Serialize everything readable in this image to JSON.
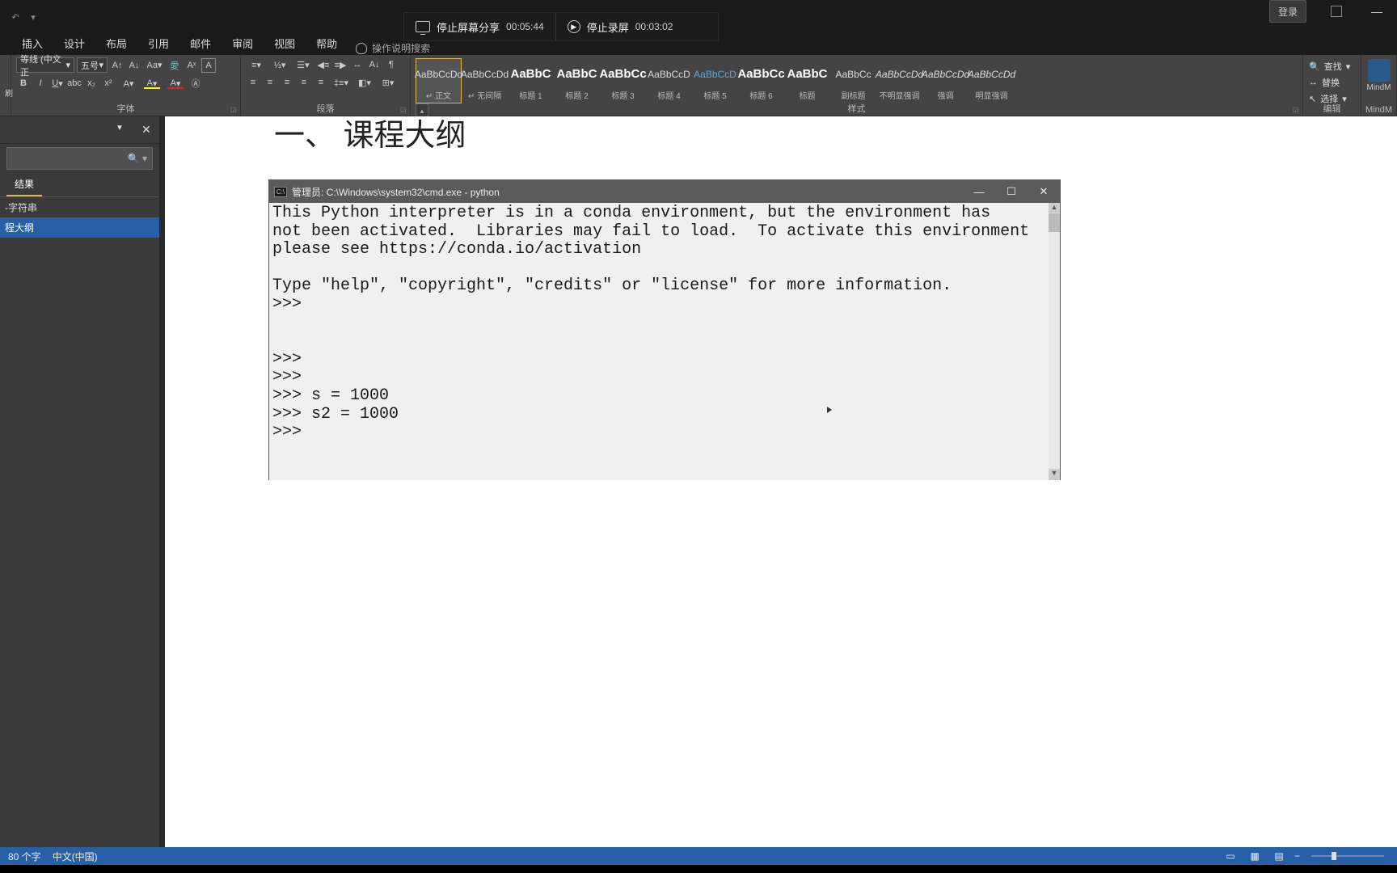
{
  "titlebar": {
    "login": "登录"
  },
  "recbar": {
    "share_label": "停止屏幕分享",
    "share_time": "00:05:44",
    "record_label": "停止录屏",
    "record_time": "00:03:02"
  },
  "ribbon_tabs": [
    "插入",
    "设计",
    "布局",
    "引用",
    "邮件",
    "审阅",
    "视图",
    "帮助"
  ],
  "search_placeholder": "操作说明搜索",
  "font": {
    "name": "等线 (中文正",
    "size": "五号"
  },
  "groups": {
    "font": "字体",
    "paragraph": "段落",
    "styles": "样式",
    "editing": "编辑",
    "mind": "MindM"
  },
  "styles": [
    {
      "preview": "AaBbCcDd",
      "name": "↵ 正文",
      "cls": ""
    },
    {
      "preview": "AaBbCcDd",
      "name": "↵ 无间隔",
      "cls": ""
    },
    {
      "preview": "AaBbC",
      "name": "标题 1",
      "cls": "h1"
    },
    {
      "preview": "AaBbC",
      "name": "标题 2",
      "cls": "h2"
    },
    {
      "preview": "AaBbCc",
      "name": "标题 3",
      "cls": "h1"
    },
    {
      "preview": "AaBbCcD",
      "name": "标题 4",
      "cls": ""
    },
    {
      "preview": "AaBbCcD",
      "name": "标题 5",
      "cls": "blue"
    },
    {
      "preview": "AaBbCc",
      "name": "标题 6",
      "cls": "h1"
    },
    {
      "preview": "AaBbC",
      "name": "标题",
      "cls": "h1"
    },
    {
      "preview": "AaBbCc",
      "name": "副标题",
      "cls": ""
    },
    {
      "preview": "AaBbCcDd",
      "name": "不明显强调",
      "cls": "ital"
    },
    {
      "preview": "AaBbCcDd",
      "name": "强调",
      "cls": "ital"
    },
    {
      "preview": "AaBbCcDd",
      "name": "明显强调",
      "cls": "ital"
    }
  ],
  "editing": {
    "find": "查找",
    "replace": "替换",
    "select": "选择"
  },
  "mind_label": "MindM",
  "nav": {
    "tab_results": "结果",
    "item_string": "-字符串",
    "item_outline": "程大纲"
  },
  "doc_heading": "一、 课程大纲",
  "terminal": {
    "title": "管理员: C:\\Windows\\system32\\cmd.exe - python",
    "lines": [
      "This Python interpreter is in a conda environment, but the environment has",
      "not been activated.  Libraries may fail to load.  To activate this environment",
      "please see https://conda.io/activation",
      "",
      "Type \"help\", \"copyright\", \"credits\" or \"license\" for more information.",
      ">>>",
      "",
      "",
      ">>>",
      ">>>",
      ">>> s = 1000",
      ">>> s2 = 1000",
      ">>> "
    ]
  },
  "statusbar": {
    "words": "80 个字",
    "lang": "中文(中国)"
  }
}
